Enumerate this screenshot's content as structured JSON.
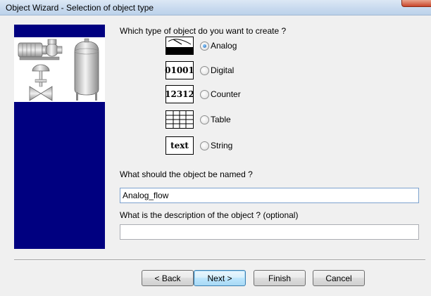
{
  "window": {
    "title": "Object Wizard - Selection of object type"
  },
  "type_question": "Which type of object do you want to create ?",
  "object_types": [
    {
      "icon_text": "",
      "icon": "analog-gauge-icon",
      "label": "Analog",
      "checked": true
    },
    {
      "icon_text": "01001",
      "icon": "digital-icon",
      "label": "Digital",
      "checked": false
    },
    {
      "icon_text": "12312",
      "icon": "counter-icon",
      "label": "Counter",
      "checked": false
    },
    {
      "icon_text": "",
      "icon": "table-grid-icon",
      "label": "Table",
      "checked": false
    },
    {
      "icon_text": "text",
      "icon": "string-icon",
      "label": "String",
      "checked": false
    }
  ],
  "name_question": "What should the object be named ?",
  "name_value": "Analog_flow",
  "description_question": "What is the description of the object ? (optional)",
  "description_value": "",
  "buttons": {
    "back": "< Back",
    "next": "Next >",
    "finish": "Finish",
    "cancel": "Cancel"
  },
  "colors": {
    "side_panel": "#000080",
    "titlebar": "#c7d9ee"
  }
}
